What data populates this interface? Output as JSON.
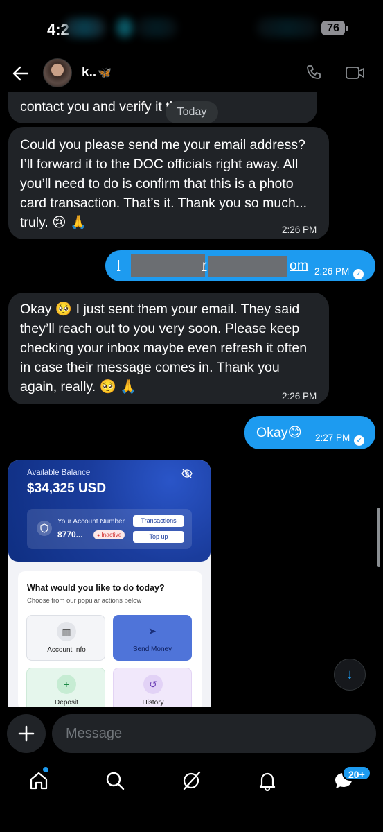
{
  "status_bar": {
    "time": "4:2",
    "battery": "76"
  },
  "header": {
    "contact_name": "k..",
    "butterfly_emoji": "🦋"
  },
  "divider": {
    "today": "Today"
  },
  "messages": [
    {
      "direction": "in",
      "text": "contact you and verify it themselves.",
      "visible_text": "contact you and verify it th     elves."
    },
    {
      "direction": "in",
      "lines": [
        "Could you please send me your email address?",
        "I’ll forward it to the DOC officials right away. All",
        "you’ll need to do is confirm that this is a photo",
        "card transaction. That’s it. Thank you so much...",
        "truly. 😢 🙏"
      ],
      "time": "2:26 PM"
    },
    {
      "direction": "out",
      "text_start": "l",
      "text_mid": "r",
      "text_end": "om",
      "time": "2:26 PM"
    },
    {
      "direction": "in",
      "lines": [
        "Okay 🥺  I just sent them your email. They said",
        "they’ll reach out to you very soon. Please keep",
        "checking your inbox maybe even refresh it often",
        "in case their message comes in. Thank you",
        "again, really. 🥺 🙏"
      ],
      "time": "2:26 PM"
    },
    {
      "direction": "out",
      "text": "Okay😊",
      "time": "2:27 PM"
    }
  ],
  "shared_image": {
    "balance_label": "Available Balance",
    "balance": "$34,325 USD",
    "account_label": "Your Account Number",
    "account_number": "8770...",
    "status": "Inactive",
    "transactions_btn": "Transactions",
    "topup_btn": "Top up",
    "question": "What would you like to do today?",
    "subtitle": "Choose from our popular actions below",
    "tiles": [
      "Account Info",
      "Send Money",
      "Deposit",
      "History"
    ]
  },
  "composer": {
    "placeholder": "Message"
  },
  "nav": {
    "badge": "20+"
  },
  "colors": {
    "accent": "#1d9bf0",
    "incoming_bubble": "#202327",
    "background": "#000000"
  },
  "icons": [
    "back-arrow-icon",
    "phone-icon",
    "video-camera-icon",
    "plus-icon",
    "home-icon",
    "search-icon",
    "grok-icon",
    "bell-icon",
    "messages-icon",
    "arrow-down-icon",
    "eye-off-icon",
    "shield-icon"
  ]
}
